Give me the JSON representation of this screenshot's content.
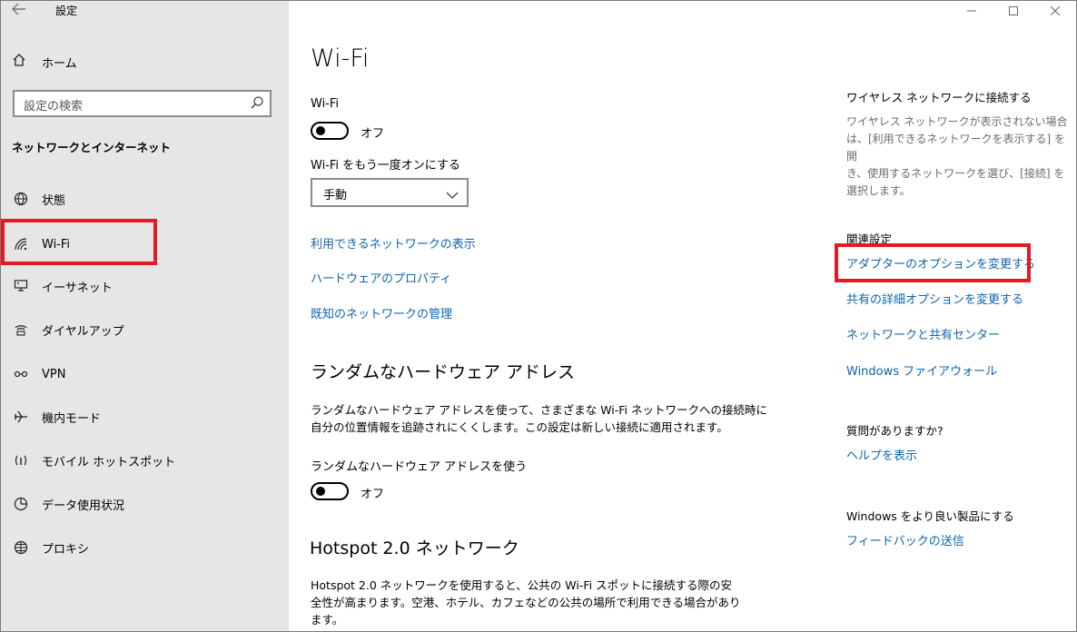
{
  "window": {
    "title": "設定",
    "back_icon": "back-arrow-icon"
  },
  "sidebar": {
    "home_label": "ホーム",
    "search_placeholder": "設定の検索",
    "section_title": "ネットワークとインターネット",
    "items": [
      {
        "label": "状態",
        "icon": "globe-status-icon"
      },
      {
        "label": "Wi-Fi",
        "icon": "wifi-icon"
      },
      {
        "label": "イーサネット",
        "icon": "ethernet-icon"
      },
      {
        "label": "ダイヤルアップ",
        "icon": "dialup-icon"
      },
      {
        "label": "VPN",
        "icon": "vpn-icon"
      },
      {
        "label": "機内モード",
        "icon": "airplane-icon"
      },
      {
        "label": "モバイル ホットスポット",
        "icon": "hotspot-icon"
      },
      {
        "label": "データ使用状況",
        "icon": "data-usage-icon"
      },
      {
        "label": "プロキシ",
        "icon": "proxy-globe-icon"
      }
    ]
  },
  "main": {
    "title": "Wi-Fi",
    "wifi_label": "Wi-Fi",
    "wifi_toggle_state": "オフ",
    "turn_on_again_label": "Wi-Fi をもう一度オンにする",
    "turn_on_again_value": "手動",
    "links": [
      "利用できるネットワークの表示",
      "ハードウェアのプロパティ",
      "既知のネットワークの管理"
    ],
    "random_hw": {
      "heading": "ランダムなハードウェア アドレス",
      "description_line1": "ランダムなハードウェア アドレスを使って、さまざまな Wi-Fi ネットワークへの接続時に",
      "description_line2": "自分の位置情報を追跡されにくくします。この設定は新しい接続に適用されます。",
      "toggle_label": "ランダムなハードウェア アドレスを使う",
      "toggle_state": "オフ"
    },
    "hotspot": {
      "heading": "Hotspot 2.0 ネットワーク",
      "description_line1": "Hotspot 2.0 ネットワークを使用すると、公共の Wi-Fi スポットに接続する際の安",
      "description_line2": "全性が高まります。空港、ホテル、カフェなどの公共の場所で利用できる場合があり",
      "description_line3": "ます。"
    }
  },
  "right": {
    "wireless_heading": "ワイヤレス ネットワークに接続する",
    "wireless_desc_line1": "ワイヤレス ネットワークが表示されない場合",
    "wireless_desc_line2": "は、[利用できるネットワークを表示する] を開",
    "wireless_desc_line3": "き、使用するネットワークを選び、[接続] を",
    "wireless_desc_line4": "選択します。",
    "related_heading": "関連設定",
    "related_links": [
      "アダプターのオプションを変更する",
      "共有の詳細オプションを変更する",
      "ネットワークと共有センター",
      "Windows ファイアウォール"
    ],
    "question_heading": "質問がありますか?",
    "help_link": "ヘルプを表示",
    "improve_heading": "Windows をより良い製品にする",
    "feedback_link": "フィードバックの送信"
  },
  "colors": {
    "accent_link": "#0e64b0",
    "highlight_red": "#e31a23",
    "sidebar_bg": "#e6e6e6"
  }
}
